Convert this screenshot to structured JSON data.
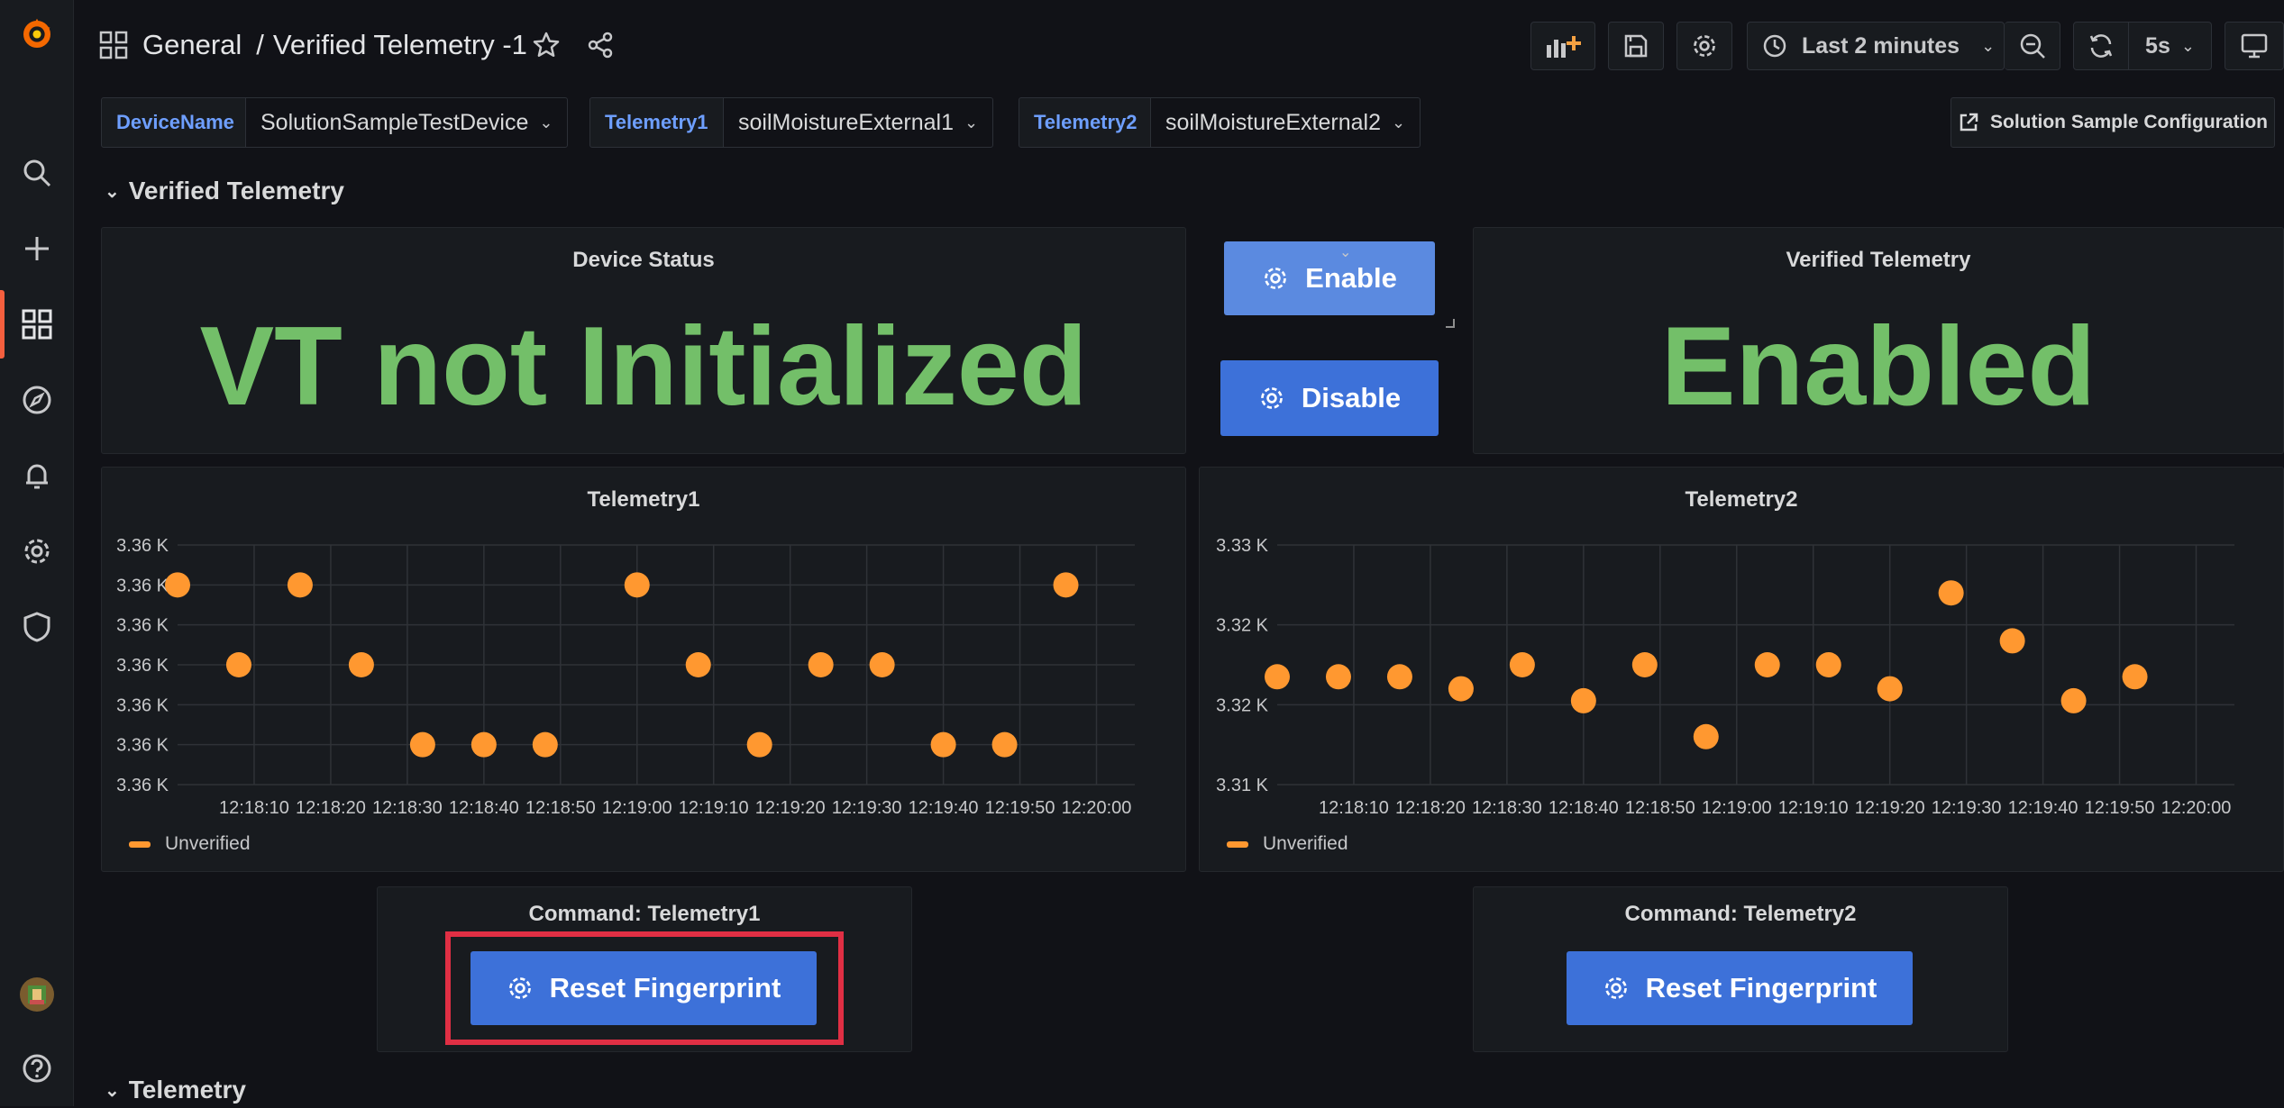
{
  "breadcrumb": {
    "folder": "General",
    "separator": "/",
    "dashboard": "Verified Telemetry -1"
  },
  "toolbar": {
    "time_range": "Last 2 minutes",
    "refresh_interval": "5s"
  },
  "variables": [
    {
      "label": "DeviceName",
      "value": "SolutionSampleTestDevice"
    },
    {
      "label": "Telemetry1",
      "value": "soilMoistureExternal1"
    },
    {
      "label": "Telemetry2",
      "value": "soilMoistureExternal2"
    }
  ],
  "config_link": "Solution Sample Configuration",
  "rows": {
    "verified": "Verified Telemetry",
    "telemetry": "Telemetry"
  },
  "device_status": {
    "title": "Device Status",
    "value": "VT not Initialized"
  },
  "vt_buttons": {
    "enable": "Enable",
    "disable": "Disable"
  },
  "verified_telemetry": {
    "title": "Verified Telemetry",
    "value": "Enabled"
  },
  "command1": {
    "title": "Command: Telemetry1",
    "button": "Reset Fingerprint"
  },
  "command2": {
    "title": "Command: Telemetry2",
    "button": "Reset Fingerprint"
  },
  "colors": {
    "accent": "#3d71d9",
    "stat_green": "#73bf69",
    "series_orange": "#ff9830",
    "highlight_red": "#e02f44"
  },
  "chart_data": [
    {
      "type": "scatter",
      "title": "Telemetry1",
      "x": [
        "12:18:05",
        "12:18:10",
        "12:18:15",
        "12:18:20",
        "12:18:25",
        "12:18:30",
        "12:18:35",
        "12:18:40",
        "12:18:45",
        "12:18:50",
        "12:18:55",
        "12:19:00",
        "12:19:05",
        "12:19:10",
        "12:19:15",
        "12:19:20",
        "12:19:25",
        "12:19:30",
        "12:19:35"
      ],
      "x_tick_labels": [
        "12:18:10",
        "12:18:20",
        "12:18:30",
        "12:18:40",
        "12:18:50",
        "12:19:00",
        "12:19:10",
        "12:19:20",
        "12:19:30",
        "12:19:40",
        "12:19:50",
        "12:20:00"
      ],
      "y_tick_labels": [
        "3.36 K",
        "3.36 K",
        "3.36 K",
        "3.36 K",
        "3.36 K",
        "3.36 K",
        "3.36 K"
      ],
      "ylim": [
        3355,
        3361
      ],
      "series": [
        {
          "name": "Unverified",
          "values": [
            3360,
            3358,
            3360,
            3358,
            3356,
            3356,
            3356,
            3360,
            3358,
            3356,
            3358,
            3358,
            3356,
            3356,
            3360
          ]
        }
      ],
      "point_x": [
        "12:18:00",
        "12:18:08",
        "12:18:16",
        "12:18:24",
        "12:18:32",
        "12:18:40",
        "12:18:48",
        "12:19:00",
        "12:19:08",
        "12:19:16",
        "12:19:24",
        "12:19:32",
        "12:19:40",
        "12:19:48",
        "12:19:56"
      ],
      "legend": "bottom-left",
      "grid": true
    },
    {
      "type": "scatter",
      "title": "Telemetry2",
      "x_tick_labels": [
        "12:18:10",
        "12:18:20",
        "12:18:30",
        "12:18:40",
        "12:18:50",
        "12:19:00",
        "12:19:10",
        "12:19:20",
        "12:19:30",
        "12:19:40",
        "12:19:50",
        "12:20:00"
      ],
      "y_tick_labels": [
        "3.33 K",
        "3.32 K",
        "3.32 K",
        "3.31 K"
      ],
      "ylim": [
        3310,
        3330
      ],
      "series": [
        {
          "name": "Unverified",
          "values": [
            3319,
            3319,
            3319,
            3318,
            3320,
            3317,
            3320,
            3314,
            3320,
            3320,
            3318,
            3326,
            3322,
            3317,
            3319
          ]
        }
      ],
      "point_x": [
        "12:18:00",
        "12:18:08",
        "12:18:16",
        "12:18:24",
        "12:18:32",
        "12:18:40",
        "12:18:48",
        "12:18:56",
        "12:19:04",
        "12:19:12",
        "12:19:20",
        "12:19:28",
        "12:19:36",
        "12:19:44",
        "12:19:52"
      ],
      "legend": "bottom-left",
      "grid": true
    }
  ]
}
